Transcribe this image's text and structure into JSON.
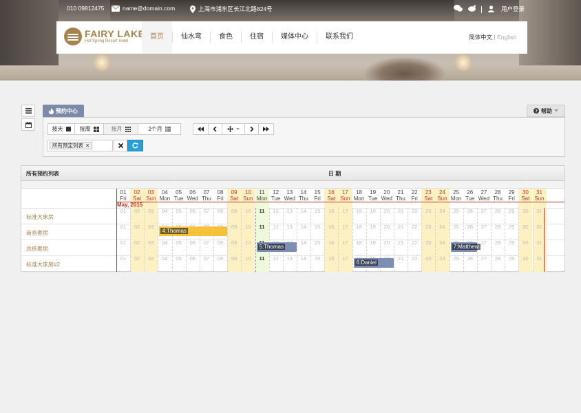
{
  "topbar": {
    "phone": "010 09812475",
    "email": "name@domain.com",
    "address": "上海市浦东区长江北路824号",
    "login": "用户登录"
  },
  "brand": {
    "name": "FAIRY LAKE",
    "tagline": "Hot Spring Resort Hotel",
    "color": "#a6824f"
  },
  "nav": {
    "items": [
      "首页",
      "仙水弯",
      "食色",
      "住宿",
      "媒体中心",
      "联系我们"
    ],
    "active_index": 0,
    "lang_cn": "简体中文",
    "lang_sep": "|",
    "lang_en": "English"
  },
  "booking": {
    "tab_label": "预约中心",
    "help_label": "帮助",
    "view_buttons": {
      "by_day": "按天",
      "by_week": "按周",
      "by_month": "按月",
      "two_months": "2个月"
    },
    "filter_chip": "所有预定列表",
    "accent": "#2a9fd6"
  },
  "grid": {
    "left_header": "所有预约列表",
    "center_header": "日 期",
    "month_label": "May, 2015",
    "rooms": [
      "标准大床房",
      "商务套房",
      "总统套房",
      "标准大床房#2"
    ],
    "days": [
      {
        "d": "01",
        "w": "Fri"
      },
      {
        "d": "02",
        "w": "Sat"
      },
      {
        "d": "03",
        "w": "Sun"
      },
      {
        "d": "04",
        "w": "Mon"
      },
      {
        "d": "05",
        "w": "Tue"
      },
      {
        "d": "06",
        "w": "Wed"
      },
      {
        "d": "07",
        "w": "Thu"
      },
      {
        "d": "08",
        "w": "Fri"
      },
      {
        "d": "09",
        "w": "Sat"
      },
      {
        "d": "10",
        "w": "Sun"
      },
      {
        "d": "11",
        "w": "Mon"
      },
      {
        "d": "12",
        "w": "Tue"
      },
      {
        "d": "13",
        "w": "Wed"
      },
      {
        "d": "14",
        "w": "Thu"
      },
      {
        "d": "15",
        "w": "Fri"
      },
      {
        "d": "16",
        "w": "Sat"
      },
      {
        "d": "17",
        "w": "Sun"
      },
      {
        "d": "18",
        "w": "Mon"
      },
      {
        "d": "19",
        "w": "Tue"
      },
      {
        "d": "20",
        "w": "Wed"
      },
      {
        "d": "21",
        "w": "Thu"
      },
      {
        "d": "22",
        "w": "Fri"
      },
      {
        "d": "23",
        "w": "Sat"
      },
      {
        "d": "24",
        "w": "Sun"
      },
      {
        "d": "25",
        "w": "Mon"
      },
      {
        "d": "26",
        "w": "Tue"
      },
      {
        "d": "27",
        "w": "Wed"
      },
      {
        "d": "28",
        "w": "Thu"
      },
      {
        "d": "29",
        "w": "Fri"
      },
      {
        "d": "30",
        "w": "Sat"
      },
      {
        "d": "31",
        "w": "Sun"
      }
    ],
    "today_index": 10,
    "reservations": [
      {
        "label": "4:Thomas",
        "row": 1,
        "start": 3,
        "end": 7,
        "color": "#f5c23a"
      },
      {
        "label": "5:Thomas",
        "row": 2,
        "start": 10,
        "end": 12,
        "color": "#7d8db3"
      },
      {
        "label": "7:Matthew",
        "row": 2,
        "start": 24,
        "end": 25,
        "color": "#7d8db3"
      },
      {
        "label": "6:Daniel",
        "row": 3,
        "start": 17,
        "end": 19,
        "color": "#7d8db3"
      }
    ]
  }
}
